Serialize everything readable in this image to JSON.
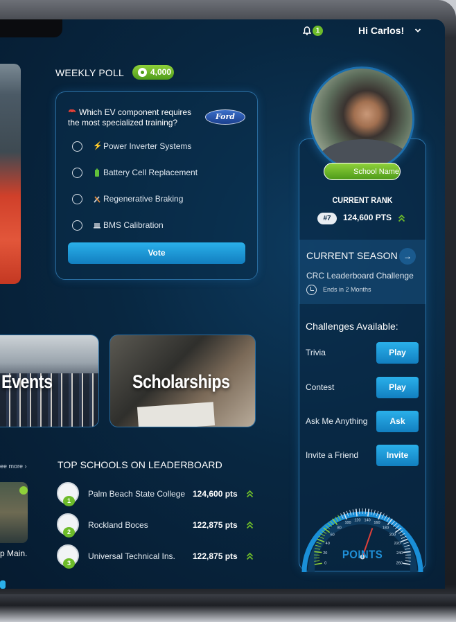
{
  "header": {
    "notification_count": "1",
    "greeting": "Hi Carlos!"
  },
  "poll": {
    "title": "WEEKLY POLL",
    "reward": "4,000",
    "question": "Which EV component requires the most specialized training?",
    "brand": "Ford",
    "options": [
      {
        "label": "Power Inverter Systems",
        "icon": "lightning-icon"
      },
      {
        "label": "Battery Cell Replacement",
        "icon": "battery-icon"
      },
      {
        "label": "Regenerative Braking",
        "icon": "tools-icon"
      },
      {
        "label": "BMS Calibration",
        "icon": "laptop-icon"
      }
    ],
    "vote_label": "Vote"
  },
  "cards": {
    "events": "Events",
    "scholarships": "Scholarships"
  },
  "left_strip": {
    "see_more": "ee more ›",
    "item_label": "p Main."
  },
  "leaderboard": {
    "title": "TOP SCHOOLS ON LEADERBOARD",
    "rows": [
      {
        "rank": "1",
        "name": "Palm Beach State College",
        "points": "124,600 pts"
      },
      {
        "rank": "2",
        "name": "Rockland Boces",
        "points": "122,875 pts"
      },
      {
        "rank": "3",
        "name": "Universal Technical Ins.",
        "points": "122,875 pts"
      }
    ]
  },
  "profile": {
    "school_name": "School Name",
    "current_rank_title": "CURRENT RANK",
    "rank": "#7",
    "points": "124,600 PTS"
  },
  "season": {
    "title": "CURRENT SEASON",
    "name": "CRC Leaderboard Challenge",
    "ends": "Ends in 2 Months"
  },
  "challenges": {
    "title": "Challenges Available:",
    "items": [
      {
        "label": "Trivia",
        "action": "Play"
      },
      {
        "label": "Contest",
        "action": "Play"
      },
      {
        "label": "Ask Me Anything",
        "action": "Ask"
      },
      {
        "label": "Invite a Friend",
        "action": "Invite"
      }
    ]
  },
  "gauge": {
    "label": "POINTS",
    "ticks": [
      "0",
      "20",
      "40",
      "60",
      "80",
      "100",
      "120",
      "140",
      "160",
      "180",
      "200",
      "220",
      "240",
      "260"
    ],
    "needle_value": 155
  },
  "colors": {
    "accent_blue": "#1f8fd6",
    "accent_green": "#6dbb2a",
    "background": "#082741"
  }
}
